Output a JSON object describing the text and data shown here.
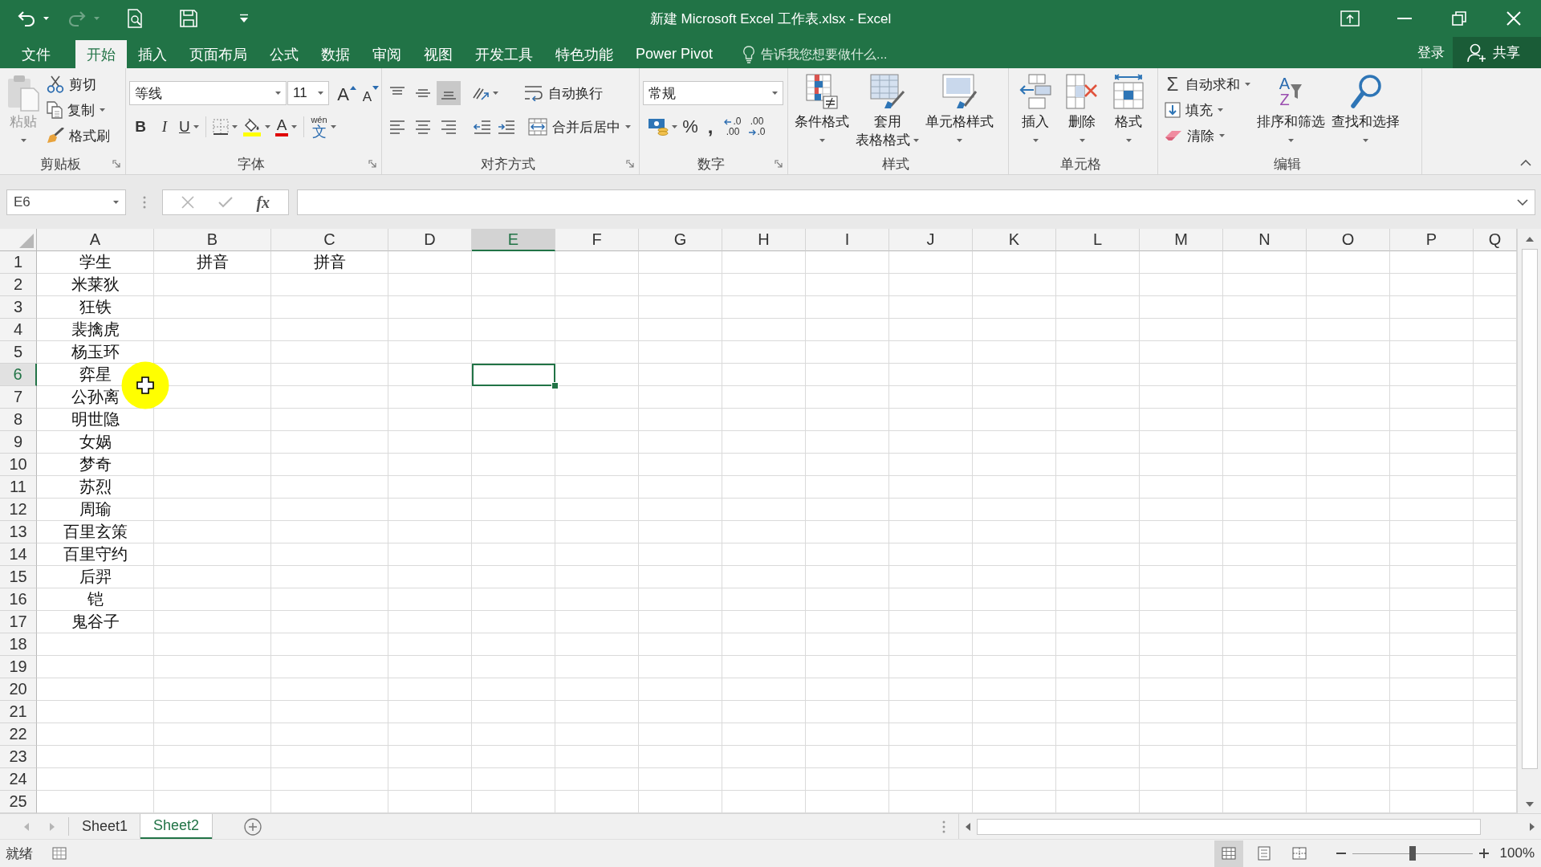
{
  "window": {
    "title": "新建 Microsoft Excel 工作表.xlsx - Excel"
  },
  "quick_access": [
    {
      "kind": "undo",
      "disabled": false
    },
    {
      "kind": "redo",
      "disabled": true
    },
    {
      "kind": "print_preview",
      "disabled": false
    },
    {
      "kind": "save",
      "disabled": false
    },
    {
      "kind": "customize",
      "disabled": false
    }
  ],
  "ribbon_tabs": [
    {
      "label": "文件",
      "selected": false
    },
    {
      "label": "开始",
      "selected": true
    },
    {
      "label": "插入",
      "selected": false
    },
    {
      "label": "页面布局",
      "selected": false
    },
    {
      "label": "公式",
      "selected": false
    },
    {
      "label": "数据",
      "selected": false
    },
    {
      "label": "审阅",
      "selected": false
    },
    {
      "label": "视图",
      "selected": false
    },
    {
      "label": "开发工具",
      "selected": false
    },
    {
      "label": "特色功能",
      "selected": false
    },
    {
      "label": "Power Pivot",
      "selected": false
    }
  ],
  "tell_me": {
    "placeholder": "告诉我您想要做什么..."
  },
  "account": {
    "sign_in": "登录",
    "share": "共享"
  },
  "ribbon_groups": [
    {
      "kind": "clipboard",
      "title": "剪贴板",
      "launcher": true,
      "paste": {
        "label": "粘贴",
        "disabled": true
      },
      "commands": [
        {
          "kind": "cut",
          "label": "剪切"
        },
        {
          "kind": "copy",
          "label": "复制"
        },
        {
          "kind": "format_painter",
          "label": "格式刷"
        }
      ]
    },
    {
      "kind": "font",
      "title": "字体",
      "launcher": true,
      "font_name": "等线",
      "font_size": "11",
      "size_buttons": [
        {
          "kind": "grow",
          "glyph": "A"
        },
        {
          "kind": "shrink",
          "glyph": "A"
        }
      ],
      "buttons": [
        {
          "kind": "bold",
          "glyph": "B"
        },
        {
          "kind": "italic",
          "glyph": "I"
        },
        {
          "kind": "underline",
          "glyph": "U"
        },
        {
          "kind": "borders"
        },
        {
          "kind": "fill_color"
        },
        {
          "kind": "font_color",
          "glyph": "A"
        },
        {
          "kind": "phonetic",
          "glyph": "文",
          "ruby": "wén"
        }
      ]
    },
    {
      "kind": "alignment",
      "title": "对齐方式",
      "launcher": true,
      "vertical_align": [
        {
          "kind": "align_top",
          "selected": false
        },
        {
          "kind": "align_middle",
          "selected": false
        },
        {
          "kind": "align_bottom",
          "selected": true
        }
      ],
      "horizontal_align": [
        {
          "kind": "align_left",
          "selected": false
        },
        {
          "kind": "align_center",
          "selected": false
        },
        {
          "kind": "align_right",
          "selected": false
        }
      ],
      "wrap_text": {
        "label": "自动换行"
      },
      "merge_center": {
        "label": "合并后居中"
      }
    },
    {
      "kind": "number",
      "title": "数字",
      "launcher": true,
      "format": "常规",
      "buttons": [
        {
          "kind": "accounting"
        },
        {
          "kind": "percent",
          "glyph": "%"
        },
        {
          "kind": "comma",
          "glyph": ","
        },
        {
          "kind": "increase_decimal",
          "glyph_top": ".0",
          "glyph_bottom": ".00"
        },
        {
          "kind": "decrease_decimal",
          "glyph_top": ".00",
          "glyph_bottom": ".0"
        }
      ]
    },
    {
      "kind": "styles",
      "title": "样式",
      "commands": [
        {
          "kind": "conditional_formatting",
          "lines": [
            "条件格式"
          ]
        },
        {
          "kind": "format_as_table",
          "lines": [
            "套用",
            "表格格式"
          ]
        },
        {
          "kind": "cell_styles",
          "lines": [
            "单元格样式"
          ]
        }
      ]
    },
    {
      "kind": "cells",
      "title": "单元格",
      "commands": [
        {
          "kind": "insert",
          "lines": [
            "插入"
          ]
        },
        {
          "kind": "delete",
          "lines": [
            "删除"
          ]
        },
        {
          "kind": "format",
          "lines": [
            "格式"
          ]
        }
      ]
    },
    {
      "kind": "editing",
      "title": "编辑",
      "small": [
        {
          "kind": "autosum",
          "glyph": "Σ",
          "label": "自动求和"
        },
        {
          "kind": "fill",
          "label": "填充"
        },
        {
          "kind": "clear",
          "label": "清除"
        }
      ],
      "large": [
        {
          "kind": "sort_filter",
          "glyph_top": "A",
          "glyph_bottom": "Z",
          "lines": [
            "排序和筛选"
          ]
        },
        {
          "kind": "find_select",
          "lines": [
            "查找和选择"
          ]
        }
      ]
    }
  ],
  "formula_bar": {
    "name_box": "E6",
    "buttons": [
      {
        "kind": "cancel",
        "disabled": true
      },
      {
        "kind": "enter",
        "disabled": true
      },
      {
        "kind": "insert_function",
        "glyph": "fx",
        "disabled": false
      }
    ]
  },
  "sheet": {
    "columns": [
      {
        "label": "A",
        "selected": false
      },
      {
        "label": "B",
        "selected": false
      },
      {
        "label": "C",
        "selected": false
      },
      {
        "label": "D",
        "selected": false
      },
      {
        "label": "E",
        "selected": true
      },
      {
        "label": "F",
        "selected": false
      },
      {
        "label": "G",
        "selected": false
      },
      {
        "label": "H",
        "selected": false
      },
      {
        "label": "I",
        "selected": false
      },
      {
        "label": "J",
        "selected": false
      },
      {
        "label": "K",
        "selected": false
      },
      {
        "label": "L",
        "selected": false
      },
      {
        "label": "M",
        "selected": false
      },
      {
        "label": "N",
        "selected": false
      },
      {
        "label": "O",
        "selected": false
      },
      {
        "label": "P",
        "selected": false
      },
      {
        "label": "Q",
        "selected": false
      }
    ],
    "rows": [
      {
        "label": "1",
        "selected": false,
        "cells": [
          "学生",
          "拼音",
          "拼音"
        ]
      },
      {
        "label": "2",
        "selected": false,
        "cells": [
          "米莱狄"
        ]
      },
      {
        "label": "3",
        "selected": false,
        "cells": [
          "狂铁"
        ]
      },
      {
        "label": "4",
        "selected": false,
        "cells": [
          "裴擒虎"
        ]
      },
      {
        "label": "5",
        "selected": false,
        "cells": [
          "杨玉环"
        ]
      },
      {
        "label": "6",
        "selected": true,
        "cells": [
          "弈星"
        ]
      },
      {
        "label": "7",
        "selected": false,
        "cells": [
          "公孙离"
        ]
      },
      {
        "label": "8",
        "selected": false,
        "cells": [
          "明世隐"
        ]
      },
      {
        "label": "9",
        "selected": false,
        "cells": [
          "女娲"
        ]
      },
      {
        "label": "10",
        "selected": false,
        "cells": [
          "梦奇"
        ]
      },
      {
        "label": "11",
        "selected": false,
        "cells": [
          "苏烈"
        ]
      },
      {
        "label": "12",
        "selected": false,
        "cells": [
          "周瑜"
        ]
      },
      {
        "label": "13",
        "selected": false,
        "cells": [
          "百里玄策"
        ]
      },
      {
        "label": "14",
        "selected": false,
        "cells": [
          "百里守约"
        ]
      },
      {
        "label": "15",
        "selected": false,
        "cells": [
          "后羿"
        ]
      },
      {
        "label": "16",
        "selected": false,
        "cells": [
          "铠"
        ]
      },
      {
        "label": "17",
        "selected": false,
        "cells": [
          "鬼谷子"
        ]
      },
      {
        "label": "18",
        "selected": false
      },
      {
        "label": "19",
        "selected": false
      },
      {
        "label": "20",
        "selected": false
      },
      {
        "label": "21",
        "selected": false
      },
      {
        "label": "22",
        "selected": false
      },
      {
        "label": "23",
        "selected": false
      },
      {
        "label": "24",
        "selected": false
      },
      {
        "label": "25",
        "selected": false
      }
    ]
  },
  "sheet_tabs": [
    {
      "label": "Sheet1",
      "selected": false
    },
    {
      "label": "Sheet2",
      "selected": true
    }
  ],
  "status_bar": {
    "status": "就绪",
    "views": [
      {
        "kind": "normal",
        "selected": true
      },
      {
        "kind": "page_layout",
        "selected": false
      },
      {
        "kind": "page_break",
        "selected": false
      }
    ],
    "zoom": {
      "level": 0.5,
      "reading": "100%"
    }
  }
}
